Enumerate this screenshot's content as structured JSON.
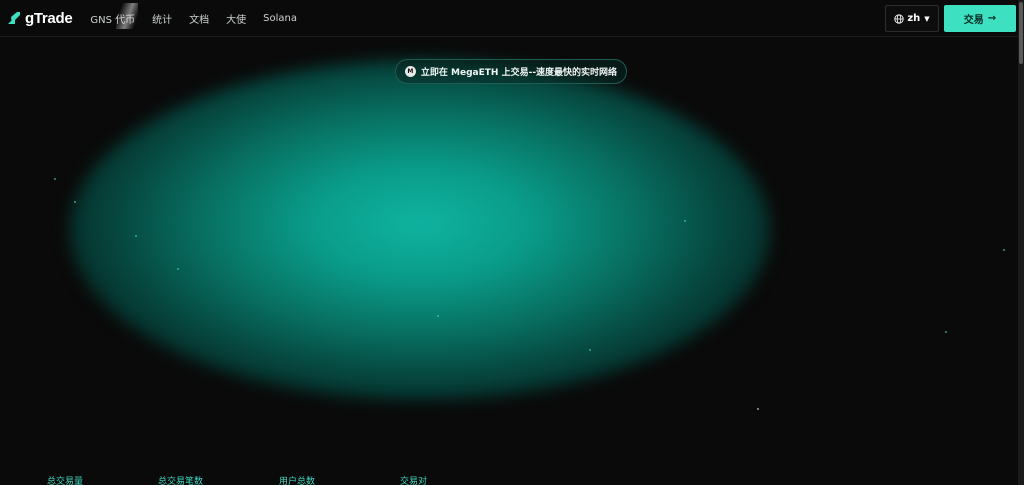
{
  "brand": {
    "name": "gTrade"
  },
  "nav": {
    "items": [
      {
        "label": "GNS 代币"
      },
      {
        "label": "统计"
      },
      {
        "label": "文档"
      },
      {
        "label": "大使"
      },
      {
        "label": "Solana"
      }
    ]
  },
  "header": {
    "language": "zh",
    "trade_button": "交易",
    "trade_arrow": "→"
  },
  "announcement": {
    "icon_letter": "M",
    "text": "立即在 MegaETH 上交易--速度最快的实时网络"
  },
  "stats": {
    "labels": [
      "总交易量",
      "总交易笔数",
      "用户总数",
      "交易对"
    ]
  },
  "colors": {
    "accent": "#3ee0c2",
    "background": "#0a0a0a",
    "glow": "#0fb4a0"
  },
  "icons": {
    "logo": "gtrade-logo-icon",
    "globe": "globe-icon",
    "caret": "caret-down-icon",
    "arrow": "arrow-right-icon",
    "announcement": "megaeth-icon"
  }
}
